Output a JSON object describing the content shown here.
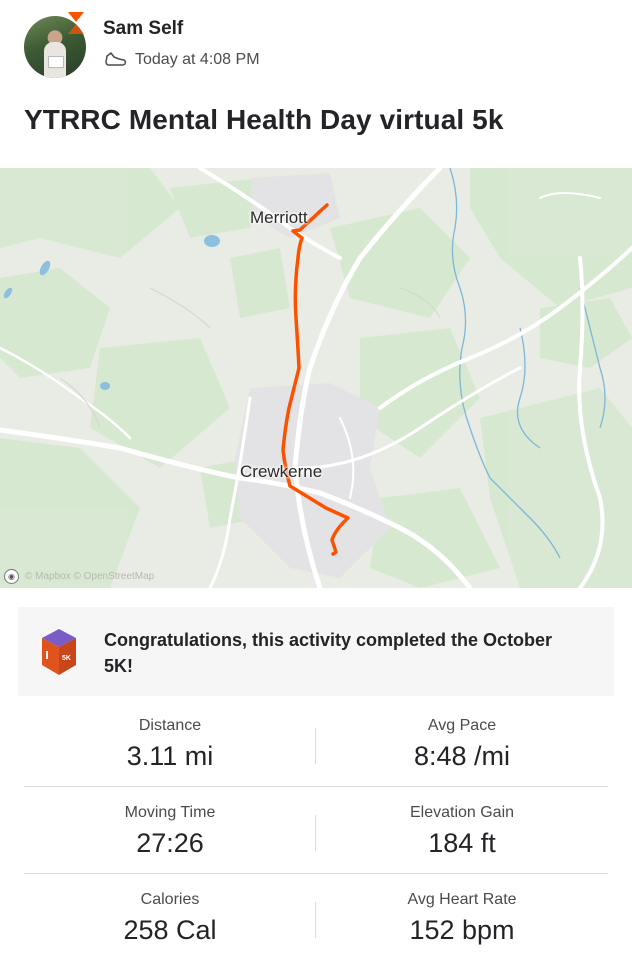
{
  "post": {
    "author": "Sam Self",
    "timestamp": "Today at 4:08 PM",
    "title": "YTRRC Mental Health Day virtual 5k",
    "activity_icon": "running-shoe-icon"
  },
  "map": {
    "labels": {
      "town_north": "Merriott",
      "town_center": "Crewkerne"
    },
    "attribution": "© Mapbox © OpenStreetMap",
    "route_color": "#fc5200"
  },
  "achievement": {
    "badge_text": "5K",
    "message": "Congratulations, this activity completed the October 5K!",
    "badge_colors": {
      "top": "#7a5cc7",
      "side": "#e0531f"
    }
  },
  "stats": [
    {
      "left": {
        "label": "Distance",
        "value": "3.11 mi"
      },
      "right": {
        "label": "Avg Pace",
        "value": "8:48 /mi"
      }
    },
    {
      "left": {
        "label": "Moving Time",
        "value": "27:26"
      },
      "right": {
        "label": "Elevation Gain",
        "value": "184 ft"
      }
    },
    {
      "left": {
        "label": "Calories",
        "value": "258 Cal"
      },
      "right": {
        "label": "Avg Heart Rate",
        "value": "152 bpm"
      }
    }
  ]
}
